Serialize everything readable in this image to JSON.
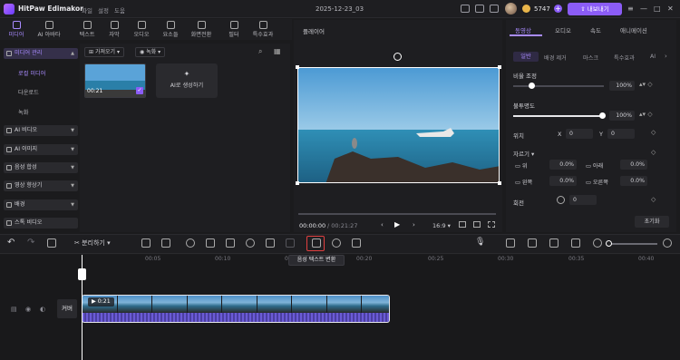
{
  "app": {
    "title": "HitPaw Edimakor",
    "menu": [
      "파일",
      "설정",
      "도움"
    ],
    "doc_title": "2025-12-23_03",
    "coins": "5747",
    "export_label": "내보내기"
  },
  "toolbar": {
    "items": [
      "미디어",
      "AI 아바타",
      "텍스트",
      "자막",
      "오디오",
      "요소들",
      "화면전환",
      "필터",
      "특수효과"
    ]
  },
  "sidebar": {
    "groups": [
      "미디어 관리",
      "AI 비디오",
      "AI 이미지",
      "음성 합성",
      "영상 향상기",
      "배경",
      "스톡 비디오"
    ],
    "subitems": [
      "로컬 미디어",
      "다운로드",
      "녹화"
    ]
  },
  "media": {
    "import_label": "가져오기",
    "record_label": "녹화",
    "thumb_duration": "00:21",
    "ai_generate_label": "AI로 생성하기"
  },
  "player": {
    "title": "플레이어",
    "current_time": "00:00:00",
    "total_time": "/ 00:21:27",
    "ratio": "16:9"
  },
  "properties": {
    "tabs": [
      "동영상",
      "오디오",
      "속도",
      "애니메이션"
    ],
    "subtabs": [
      "일반",
      "배경 제거",
      "마스크",
      "특수효과",
      "AI"
    ],
    "ratio_label": "비율 조정",
    "ratio_value": "100%",
    "opacity_label": "불투명도",
    "opacity_value": "100%",
    "position_label": "위치",
    "x_label": "X",
    "x_value": "0",
    "y_label": "Y",
    "y_value": "0",
    "crop_label": "자르기",
    "crop_top_label": "위",
    "crop_top_value": "0.0%",
    "crop_bottom_label": "아래",
    "crop_bottom_value": "0.0%",
    "crop_left_label": "왼쪽",
    "crop_left_value": "0.0%",
    "crop_right_label": "오른쪽",
    "crop_right_value": "0.0%",
    "rotate_label": "회전",
    "rotate_value": "0",
    "reset_label": "초기화"
  },
  "timeline": {
    "split_label": "분리하기",
    "ruler": [
      "00:05",
      "00:10",
      "00:15",
      "00:20",
      "00:25",
      "00:30",
      "00:35",
      "00:40"
    ],
    "clip_duration": "0:21",
    "cover_label": "커버",
    "tooltip": "음성 텍스트 변환"
  }
}
